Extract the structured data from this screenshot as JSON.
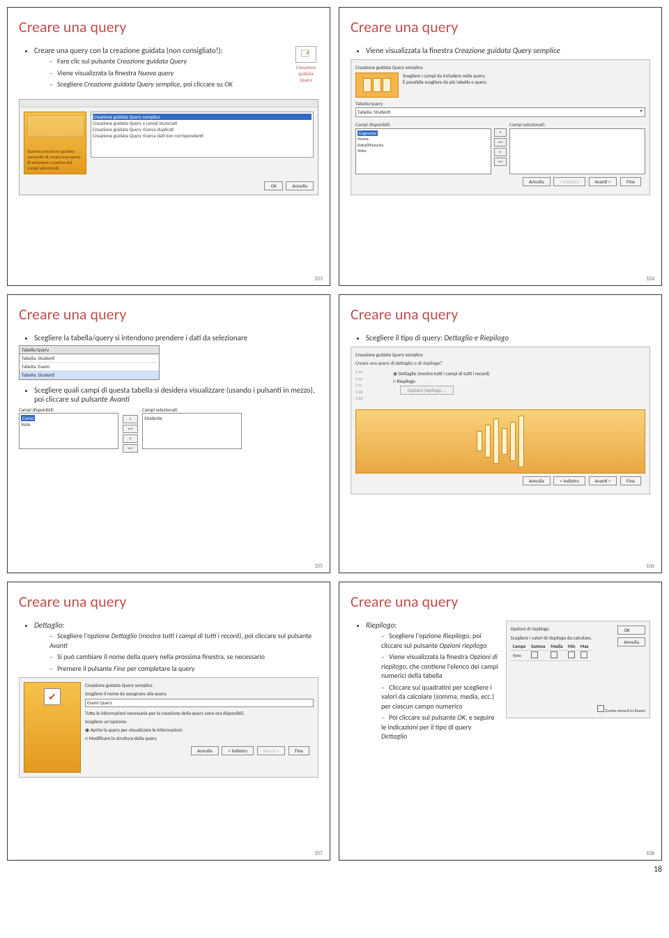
{
  "page_number": "18",
  "slides": [
    {
      "num": "103",
      "title": "Creare una query",
      "b1": "Creare una query con la creazione guidata (non consigliato!):",
      "s1": "Fare clic sul pulsante ",
      "s1_em": "Creazione guidata Query",
      "s2_a": "Viene visualizzata la finestra ",
      "s2_em": "Nuova query",
      "s3_a": "Scegliere ",
      "s3_em": "Creazione guidata Query semplice",
      "s3_b": ", poi cliccare su ",
      "s3_em2": "OK",
      "icon_label": "Creazione guidata Query",
      "list1": "Creazione guidata Query semplice",
      "list2": "Creazione guidata Query a campi incrociati",
      "list3": "Creazione guidata Query ricerca duplicati",
      "list4": "Creazione guidata Query ricerca dati non corrispondenti",
      "help": "Questa procedura guidata consente di creare una query di selezione a partire dai campi selezionati.",
      "ok": "OK",
      "cancel": "Annulla"
    },
    {
      "num": "104",
      "title": "Creare una query",
      "b1_a": "Viene visualizzata la finestra ",
      "b1_em": "Creazione guidata Query semplice",
      "wiz_title": "Creazione guidata Query semplice",
      "headline1": "Scegliere i campi da includere nella query.",
      "headline2": "È possibile scegliere da più tabelle o query.",
      "lbl_tab": "Tabelle/query",
      "dd_val": "Tabella: Studenti",
      "lbl_disp": "Campi disponibili:",
      "lbl_sel": "Campi selezionati:",
      "f1": "Cognome",
      "f2": "Nome",
      "f3": "DataDiNascita",
      "f4": "Voto",
      "btn_add": ">",
      "btn_addall": ">>",
      "btn_rem": "<",
      "btn_remall": "<<",
      "btn_cancel": "Annulla",
      "btn_back": "< Indietro",
      "btn_next": "Avanti >",
      "btn_fine": "Fine"
    },
    {
      "num": "105",
      "title": "Creare una query",
      "b1": "Scegliere la tabella/query si intendono prendere i dati da selezionare",
      "tq_label": "Tabelle/query",
      "tq1": "Tabella: Studenti",
      "tq2": "Tabella: Esami",
      "tq3": "Tabella: Studenti",
      "b2_a": "Scegliere quali campi di questa tabella si desidera visualizzare (usando i pulsanti in mezzo), poi cliccare sul pulsante ",
      "b2_em": "Avanti",
      "lbl_disp": "Campi disponibili:",
      "lbl_sel": "Campi selezionati:",
      "cd1": "Corso",
      "cd2": "Voto",
      "cs1": "Studente",
      "btn_add": ">",
      "btn_addall": ">>",
      "btn_rem": "<",
      "btn_remall": "<<"
    },
    {
      "num": "106",
      "title": "Creare una query",
      "b1_a": "Scegliere il tipo di query: ",
      "b1_em1": "Dettaglio",
      "b1_mid": " e ",
      "b1_em2": "Riepilogo",
      "wiz_title": "Creazione guidata Query semplice",
      "q": "Creare una query di dettaglio o di riepilogo?",
      "r1": "Dettaglio (mostra tutti i campi di tutti i record)",
      "r2": "Riepilogo",
      "opts": "Opzioni riepilogo ...",
      "btn_cancel": "Annulla",
      "btn_back": "< Indietro",
      "btn_next": "Avanti >",
      "btn_fine": "Fine"
    },
    {
      "num": "107",
      "title": "Creare una query",
      "b0": "Dettaglio",
      "s1_a": "Scegliere l'opzione ",
      "s1_em": "Dettaglio (mostra tutti i campi di tutti i record)",
      "s1_b": ", poi cliccare sul pulsante ",
      "s1_em2": "Avanti",
      "s2": "Si può cambiare il nome della query nella prossima finestra, se necessario",
      "s3_a": "Premere il pulsante ",
      "s3_em": "Fine",
      "s3_b": " per completare la query",
      "wiz_title": "Creazione guidata Query semplice",
      "q1": "Scegliere il nome da assegnare alla query.",
      "inp": "Esami Query",
      "q2": "Tutte le informazioni necessarie per la creazione della query sono ora disponibili.",
      "q3": "Scegliere un'opzione:",
      "r1": "Aprire la query per visualizzare le informazioni.",
      "r2": "Modificare la struttura della query.",
      "btn_cancel": "Annulla",
      "btn_back": "< Indietro",
      "btn_next": "Avanti >",
      "btn_fine": "Fine"
    },
    {
      "num": "108",
      "title": "Creare una query",
      "b0": "Riepilogo",
      "s1_a": "Scegliere l'opzione ",
      "s1_em": "Riepilogo",
      "s1_b": ", poi cliccare sul pulsante ",
      "s1_em2": "Opzioni riepilogo",
      "s2_a": "Viene visualizzata la finestra ",
      "s2_em": "Opzioni di riepilogo",
      "s2_b": ", che contiene l'elenco dei campi numerici della tabella",
      "s3": "Cliccare sui quadratini per scegliere i valori da calcolare (somma, media, ecc.) per ciascun campo numerico",
      "s4_a": "Poi cliccare sul pulsante ",
      "s4_em": "OK",
      "s4_b": ", e seguire le indicazioni per il tipo di query ",
      "s4_em2": "Dettaglio",
      "dlg_title": "Opzioni di riepilogo",
      "dlg_sub": "Scegliere i valori di riepilogo da calcolare.",
      "th_campo": "Campo",
      "th_s": "Somma",
      "th_m": "Media",
      "th_mi": "Min",
      "th_ma": "Max",
      "row1": "Voto",
      "ok": "OK",
      "cancel": "Annulla",
      "foot": "Conta record in Esami"
    }
  ]
}
